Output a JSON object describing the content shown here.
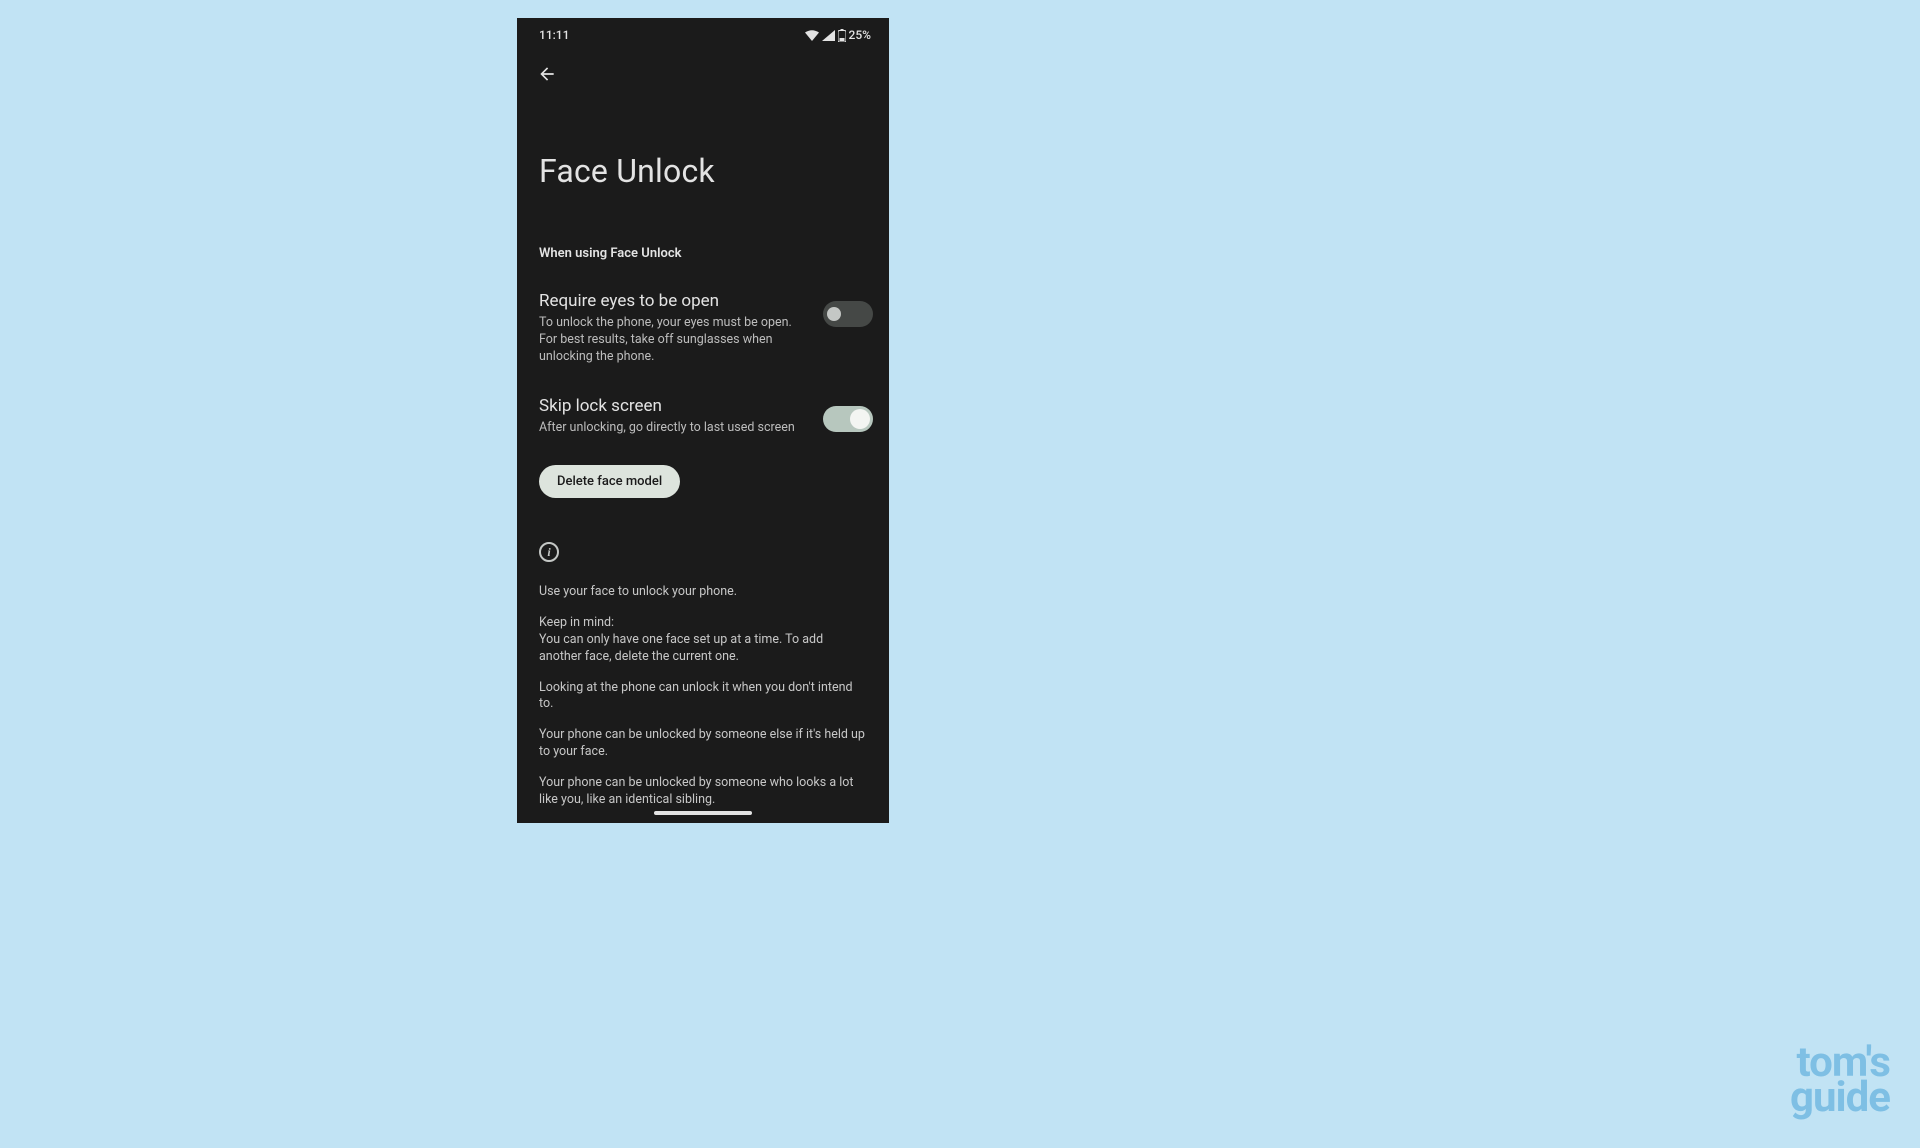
{
  "status": {
    "time": "11:11",
    "battery": "25%"
  },
  "page": {
    "title": "Face Unlock"
  },
  "section_label": "When using Face Unlock",
  "settings": {
    "require_eyes": {
      "title": "Require eyes to be open",
      "desc": "To unlock the phone, your eyes must be open. For best results, take off sunglasses when unlocking the phone.",
      "enabled": false
    },
    "skip_lock": {
      "title": "Skip lock screen",
      "desc": "After unlocking, go directly to last used screen",
      "enabled": true
    }
  },
  "delete_button": "Delete face model",
  "info": {
    "p1": "Use your face to unlock your phone.",
    "p2a": "Keep in mind:",
    "p2b": "You can only have one face set up at a time. To add another face, delete the current one.",
    "p3": "Looking at the phone can unlock it when you don't intend to.",
    "p4": "Your phone can be unlocked by someone else if it's held up to your face.",
    "p5": "Your phone can be unlocked by someone who looks a lot like you, like an identical sibling."
  },
  "watermark": {
    "line1": "tom's",
    "line2": "guide"
  }
}
